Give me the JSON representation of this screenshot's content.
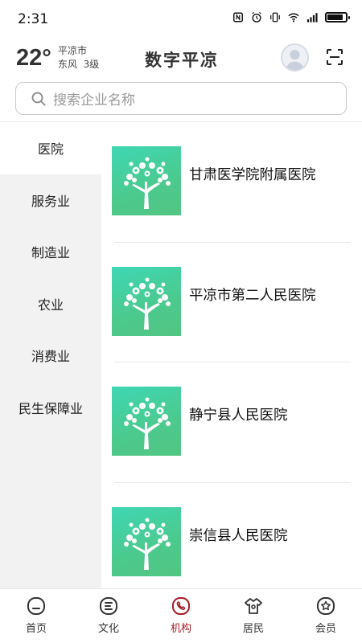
{
  "status_bar": {
    "time": "2:31",
    "icons": [
      "nfc-icon",
      "alarm-icon",
      "vibrate-icon",
      "wifi-icon",
      "signal-icon",
      "battery-icon"
    ],
    "battery_level": 0.85
  },
  "header": {
    "temperature": "22°",
    "city": "平凉市",
    "wind": "东风  3级",
    "app_title": "数字平凉"
  },
  "search": {
    "placeholder": "搜索企业名称"
  },
  "categories": [
    {
      "label": "医院",
      "active": true
    },
    {
      "label": "服务业",
      "active": false
    },
    {
      "label": "制造业",
      "active": false
    },
    {
      "label": "农业",
      "active": false
    },
    {
      "label": "消费业",
      "active": false
    },
    {
      "label": "民生保障业",
      "active": false
    }
  ],
  "institutions": [
    {
      "name": "甘肃医学院附属医院"
    },
    {
      "name": "平凉市第二人民医院"
    },
    {
      "name": "静宁县人民医院"
    },
    {
      "name": "崇信县人民医院"
    }
  ],
  "tabbar": {
    "items": [
      {
        "label": "首页",
        "icon": "home-icon",
        "active": false
      },
      {
        "label": "文化",
        "icon": "culture-icon",
        "active": false
      },
      {
        "label": "机构",
        "icon": "institution-icon",
        "active": true
      },
      {
        "label": "居民",
        "icon": "resident-icon",
        "active": false
      },
      {
        "label": "会员",
        "icon": "member-icon",
        "active": false
      }
    ]
  },
  "colors": {
    "accent": "#a51d26",
    "sidebar_bg": "#f2f2f2",
    "thumb_green": "#4cc98d"
  }
}
